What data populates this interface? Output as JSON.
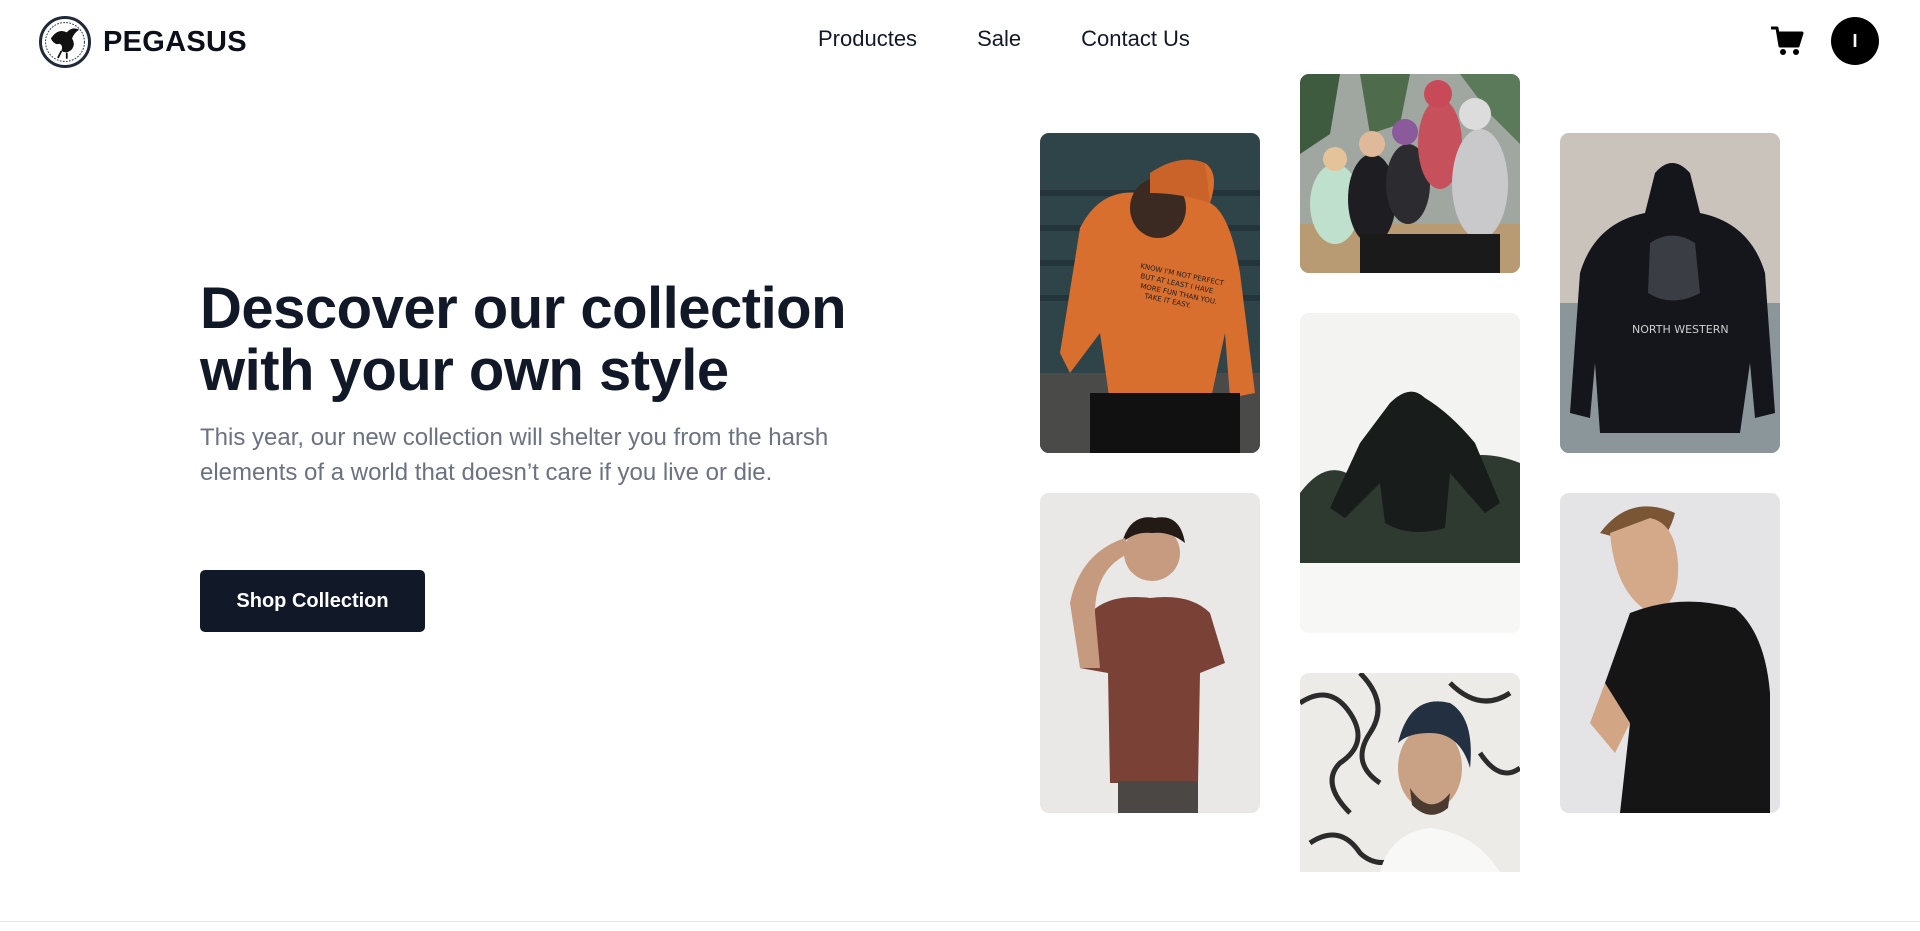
{
  "brand": {
    "name": "PEGASUS",
    "logo_icon": "pegasus-logo-icon"
  },
  "nav": {
    "items": [
      "Productes",
      "Sale",
      "Contact Us"
    ]
  },
  "header": {
    "cart_icon": "shopping-cart-icon",
    "avatar_initial": "I"
  },
  "hero": {
    "headline": "Descover our collection with your own style",
    "description": "This year, our new collection will shelter you from the harsh elements of a world that doesn’t care if you live or die.",
    "cta_label": "Shop Collection"
  },
  "gallery": {
    "hoodie_print_text": "KNOW I'M NOT PERFECT BUT AT LEAST I HAVE MORE FUN THAN YOU. TAKE IT EASY.",
    "back_print_text": "NORTH WESTERN"
  },
  "colors": {
    "primary": "#111827",
    "text_muted": "#6b7280",
    "background": "#ffffff"
  }
}
